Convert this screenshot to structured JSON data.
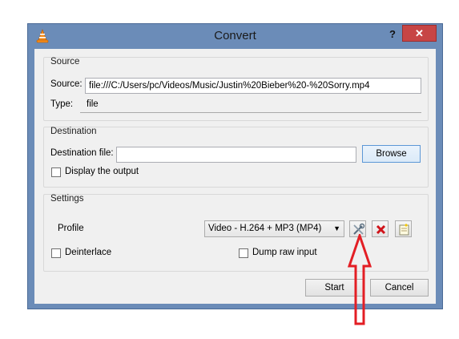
{
  "window": {
    "title": "Convert",
    "help_label": "?",
    "close_label": "✕"
  },
  "source": {
    "group_title": "Source",
    "source_label": "Source:",
    "source_value": "file:///C:/Users/pc/Videos/Music/Justin%20Bieber%20-%20Sorry.mp4",
    "type_label": "Type:",
    "type_value": "file"
  },
  "destination": {
    "group_title": "Destination",
    "file_label": "Destination file:",
    "file_value": "",
    "browse_label": "Browse",
    "display_output_label": "Display the output",
    "display_output_checked": false
  },
  "settings": {
    "group_title": "Settings",
    "profile_label": "Profile",
    "profile_selected": "Video - H.264 + MP3 (MP4)",
    "deinterlace_label": "Deinterlace",
    "deinterlace_checked": false,
    "dump_raw_label": "Dump raw input",
    "dump_raw_checked": false,
    "icons": [
      "edit-profile-icon",
      "delete-profile-icon",
      "new-profile-icon"
    ]
  },
  "buttons": {
    "start_label": "Start",
    "cancel_label": "Cancel"
  },
  "annotation": {
    "arrow_color": "#e31e24"
  },
  "colors": {
    "title_bar": "#6b8cb8",
    "close_button": "#c74545",
    "client_bg": "#f0f0f0"
  }
}
